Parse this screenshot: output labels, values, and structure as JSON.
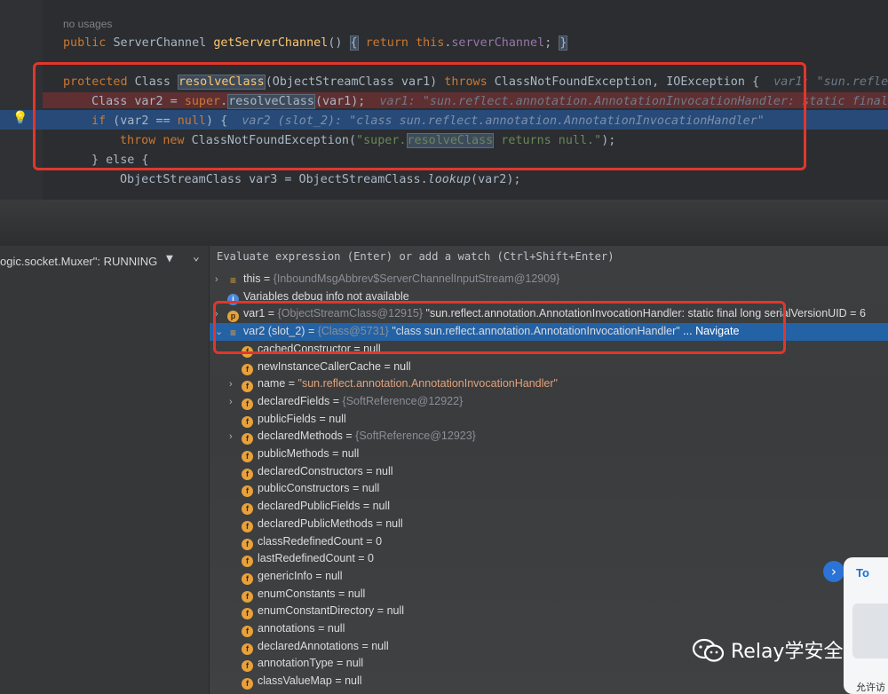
{
  "editor": {
    "no_usages": "no usages",
    "line1": {
      "kw1": "public",
      "type": "ServerChannel",
      "method": "getServerChannel",
      "paren": "()",
      "brace_open": "{",
      "kw2": "return",
      "kw3": "this",
      "field": "serverChannel",
      "end": ";",
      "brace_close": "}"
    },
    "line2": {
      "kw1": "protected",
      "type": "Class",
      "method": "resolveClass",
      "params": "(ObjectStreamClass var1)",
      "kw2": "throws",
      "ex": "ClassNotFoundException, IOException {",
      "inline": "var1: \"sun.reflect"
    },
    "line3": {
      "decl": "Class var2 = ",
      "kw": "super",
      "dot": ".",
      "method": "resolveClass",
      "args": "(var1);",
      "inline": "var1: \"sun.reflect.annotation.AnnotationInvocationHandler: static final l"
    },
    "line4": {
      "kw1": "if",
      "cond1": " (var2 == ",
      "kw2": "null",
      "cond2": ") {",
      "inline": "var2 (slot_2): \"class sun.reflect.annotation.AnnotationInvocationHandler\""
    },
    "line5": {
      "kw1": "throw",
      "kw2": "new",
      "ctor": "ClassNotFoundException(",
      "str_open": "\"super.",
      "str_mid": "resolveClass",
      "str_end": " returns null.\"",
      "end": ");"
    },
    "line6": {
      "text": "} else {"
    },
    "line7": {
      "decl": "ObjectStreamClass var3 = ObjectStreamClass.",
      "method": "lookup",
      "args": "(var2);"
    }
  },
  "debugger": {
    "thread_label": "ogic.socket.Muxer\": RUNNING",
    "eval_placeholder": "Evaluate expression (Enter) or add a watch (Ctrl+Shift+Enter)",
    "variables": [
      {
        "name": "this",
        "value": "{InboundMsgAbbrev$ServerChannelInputStream@12909}",
        "kind": "lines",
        "toggle": "›"
      },
      {
        "name": "Variables debug info not available",
        "value": "",
        "kind": "info",
        "toggle": ""
      },
      {
        "name": "var1",
        "value": "{ObjectStreamClass@12915}",
        "extra": "\"sun.reflect.annotation.AnnotationInvocationHandler: static final long serialVersionUID = 6",
        "kind": "p",
        "toggle": "›"
      },
      {
        "name": "var2 (slot_2)",
        "value": "{Class@5731}",
        "extra": "\"class sun.reflect.annotation.AnnotationInvocationHandler\"",
        "nav": "... Navigate",
        "kind": "lines",
        "toggle": "⌄"
      },
      {
        "name": "cachedConstructor",
        "value": "null",
        "kind": "f",
        "toggle": ""
      },
      {
        "name": "newInstanceCallerCache",
        "value": "null",
        "kind": "f",
        "toggle": ""
      },
      {
        "name": "name",
        "value": "\"sun.reflect.annotation.AnnotationInvocationHandler\"",
        "kind": "f",
        "toggle": "›"
      },
      {
        "name": "declaredFields",
        "value": "{SoftReference@12922}",
        "kind": "f",
        "toggle": "›"
      },
      {
        "name": "publicFields",
        "value": "null",
        "kind": "f",
        "toggle": ""
      },
      {
        "name": "declaredMethods",
        "value": "{SoftReference@12923}",
        "kind": "f",
        "toggle": "›"
      },
      {
        "name": "publicMethods",
        "value": "null",
        "kind": "f",
        "toggle": ""
      },
      {
        "name": "declaredConstructors",
        "value": "null",
        "kind": "f",
        "toggle": ""
      },
      {
        "name": "publicConstructors",
        "value": "null",
        "kind": "f",
        "toggle": ""
      },
      {
        "name": "declaredPublicFields",
        "value": "null",
        "kind": "f",
        "toggle": ""
      },
      {
        "name": "declaredPublicMethods",
        "value": "null",
        "kind": "f",
        "toggle": ""
      },
      {
        "name": "classRedefinedCount",
        "value": "0",
        "kind": "f",
        "toggle": ""
      },
      {
        "name": "lastRedefinedCount",
        "value": "0",
        "kind": "f",
        "toggle": ""
      },
      {
        "name": "genericInfo",
        "value": "null",
        "kind": "f",
        "toggle": ""
      },
      {
        "name": "enumConstants",
        "value": "null",
        "kind": "f",
        "toggle": ""
      },
      {
        "name": "enumConstantDirectory",
        "value": "null",
        "kind": "f",
        "toggle": ""
      },
      {
        "name": "annotations",
        "value": "null",
        "kind": "f",
        "toggle": ""
      },
      {
        "name": "declaredAnnotations",
        "value": "null",
        "kind": "f",
        "toggle": ""
      },
      {
        "name": "annotationType",
        "value": "null",
        "kind": "f",
        "toggle": ""
      },
      {
        "name": "classValueMap",
        "value": "null",
        "kind": "f",
        "toggle": ""
      }
    ]
  },
  "overlay": {
    "toast_title": "To",
    "toast_bottom": "允许访",
    "arrow": "›",
    "watermark": "Relay学安全"
  },
  "colors": {
    "highlight_box": "#e1362d",
    "selection": "#2462a6",
    "current_line": "#274a78"
  }
}
